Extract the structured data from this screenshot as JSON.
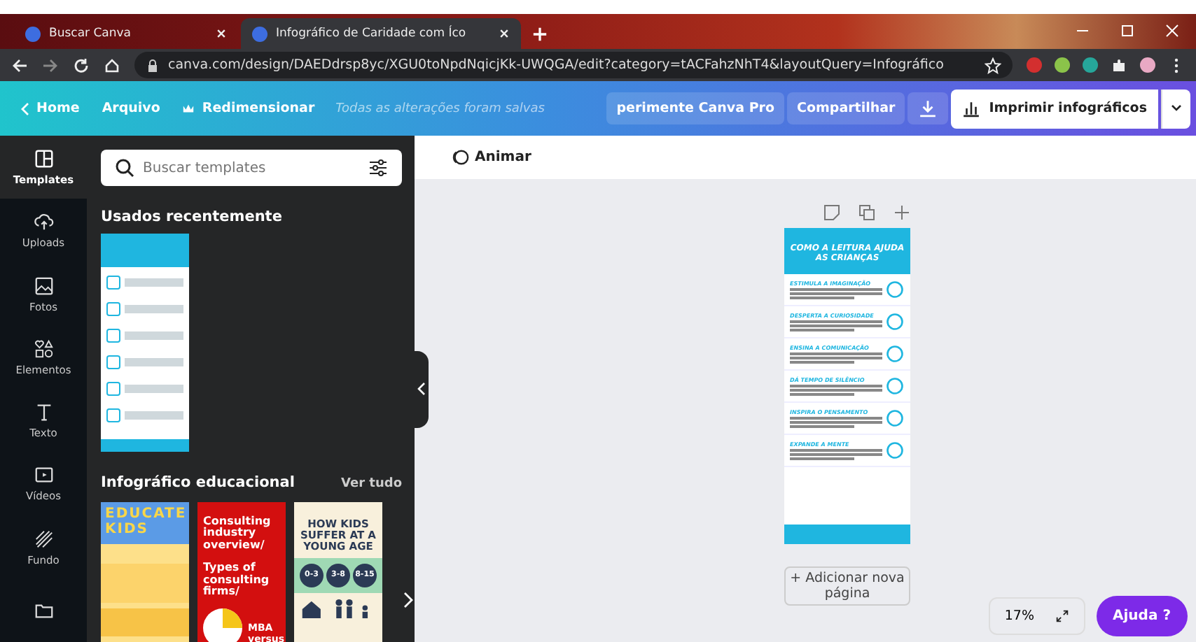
{
  "browser": {
    "tabs": [
      {
        "title": "Buscar  Canva",
        "selected": false
      },
      {
        "title": "Infográfico de Caridade com Íco",
        "selected": true
      }
    ],
    "url": "canva.com/design/DAEDdrsp8yc/XGU0toNpdNqicjKk-UWQGA/edit?category=tACFahzNhT4&layoutQuery=Infográfico"
  },
  "header": {
    "home": "Home",
    "menu": [
      "Arquivo",
      "Redimensionar"
    ],
    "status": "Todas as alterações foram salvas",
    "pro": "perimente Canva Pro",
    "share": "Compartilhar",
    "print": "Imprimir infográficos"
  },
  "rail": [
    {
      "label": "Templates",
      "selected": true
    },
    {
      "label": "Uploads",
      "selected": false
    },
    {
      "label": "Fotos",
      "selected": false
    },
    {
      "label": "Elementos",
      "selected": false
    },
    {
      "label": "Texto",
      "selected": false
    },
    {
      "label": "Vídeos",
      "selected": false
    },
    {
      "label": "Fundo",
      "selected": false
    },
    {
      "selected": false
    }
  ],
  "panel": {
    "search": {
      "placeholder": "Buscar templates"
    },
    "recent_title": "Usados recentemente",
    "section_title": "Infográfico educacional",
    "see_all": "Ver tudo",
    "templates": [
      {
        "kind": "educate",
        "lines": [
          "EDUCATE",
          "KIDS"
        ]
      },
      {
        "kind": "consulting",
        "lines": [
          "Consulting industry overview/",
          "Types of consulting firms/",
          "MBA versus"
        ]
      },
      {
        "kind": "kids",
        "lines": [
          "HOW KIDS SUFFER AT A YOUNG AGE",
          "0-3",
          "3-8",
          "8-15"
        ]
      }
    ]
  },
  "toolbar": {
    "animate": "Animar"
  },
  "design": {
    "title": "COMO A LEITURA AJUDA AS CRIANÇAS",
    "sections": [
      "ESTIMULA A IMAGINAÇÃO",
      "DESPERTA A CURIOSIDADE",
      "ENSINA A COMUNICAÇÃO",
      "DÁ TEMPO DE SILÊNCIO",
      "INSPIRA O PENSAMENTO",
      "EXPANDE A MENTE"
    ]
  },
  "add_page": "+ Adicionar nova página",
  "zoom": "17%",
  "help": "Ajuda ?"
}
